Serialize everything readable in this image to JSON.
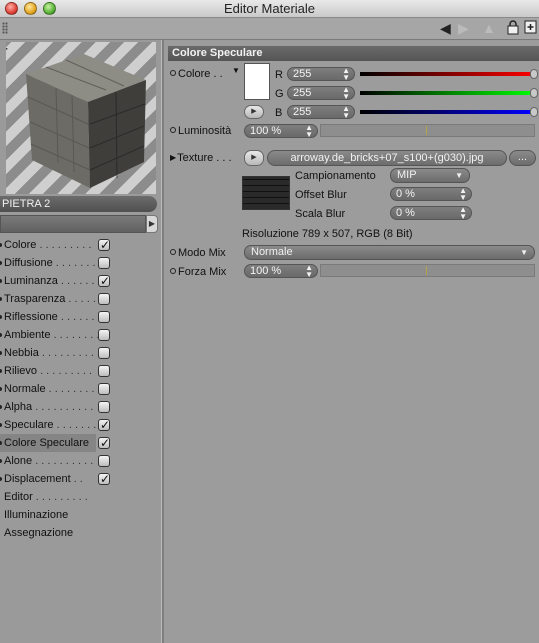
{
  "window": {
    "title": "Editor Materiale"
  },
  "toolbar": {
    "icons": [
      "back-arrow-icon",
      "forward-arrow-icon",
      "up-arrow-icon",
      "lock-icon",
      "new-window-icon"
    ]
  },
  "preview": {
    "material_name": "PIETRA 2"
  },
  "channels": [
    {
      "label": "Colore",
      "dots": " . . . . . . . . .",
      "checkbox": true,
      "checked": true,
      "bullet": true,
      "selected": false
    },
    {
      "label": "Diffusione",
      "dots": " . . . . . . .",
      "checkbox": true,
      "checked": false,
      "bullet": true,
      "selected": false
    },
    {
      "label": "Luminanza",
      "dots": " . . . . . .",
      "checkbox": true,
      "checked": true,
      "bullet": true,
      "selected": false
    },
    {
      "label": "Trasparenza",
      "dots": " . . . . .",
      "checkbox": true,
      "checked": false,
      "bullet": true,
      "selected": false
    },
    {
      "label": "Riflessione",
      "dots": " . . . . . .",
      "checkbox": true,
      "checked": false,
      "bullet": true,
      "selected": false
    },
    {
      "label": "Ambiente",
      "dots": " . . . . . . . .",
      "checkbox": true,
      "checked": false,
      "bullet": true,
      "selected": false
    },
    {
      "label": "Nebbia",
      "dots": " . . . . . . . . .",
      "checkbox": true,
      "checked": false,
      "bullet": true,
      "selected": false
    },
    {
      "label": "Rilievo",
      "dots": " . . . . . . . . .",
      "checkbox": true,
      "checked": false,
      "bullet": true,
      "selected": false
    },
    {
      "label": "Normale",
      "dots": " . . . . . . . .",
      "checkbox": true,
      "checked": false,
      "bullet": true,
      "selected": false
    },
    {
      "label": "Alpha",
      "dots": " . . . . . . . . . .",
      "checkbox": true,
      "checked": false,
      "bullet": true,
      "selected": false
    },
    {
      "label": "Speculare",
      "dots": " . . . . . . .",
      "checkbox": true,
      "checked": true,
      "bullet": true,
      "selected": false
    },
    {
      "label": "Colore Speculare",
      "dots": "",
      "checkbox": true,
      "checked": true,
      "bullet": true,
      "selected": true
    },
    {
      "label": "Alone",
      "dots": " . . . . . . . . . .",
      "checkbox": true,
      "checked": false,
      "bullet": true,
      "selected": false
    },
    {
      "label": "Displacement",
      "dots": " . .",
      "checkbox": true,
      "checked": true,
      "bullet": true,
      "selected": false
    },
    {
      "label": "Editor",
      "dots": " . . . . . . . . .",
      "checkbox": false,
      "checked": false,
      "bullet": false,
      "selected": false
    },
    {
      "label": "Illuminazione",
      "dots": "",
      "checkbox": false,
      "checked": false,
      "bullet": false,
      "selected": false
    },
    {
      "label": "Assegnazione",
      "dots": "",
      "checkbox": false,
      "checked": false,
      "bullet": false,
      "selected": false
    }
  ],
  "panel": {
    "section_title": "Colore Speculare",
    "colore": {
      "label": "Colore . .",
      "swatch_color": "#ffffff",
      "r_label": "R",
      "r_value": "255",
      "g_label": "G",
      "g_value": "255",
      "b_label": "B",
      "b_value": "255"
    },
    "luminosita": {
      "label": "Luminosità",
      "value": "100 %"
    },
    "texture": {
      "label": "Texture . . .",
      "filename": "arroway.de_bricks+07_s100+(g030).jpg",
      "more_button": "...",
      "campionamento_label": "Campionamento",
      "campionamento_value": "MIP",
      "offset_blur_label": "Offset Blur",
      "offset_blur_value": "0 %",
      "scala_blur_label": "Scala Blur",
      "scala_blur_value": "0 %",
      "resolution": "Risoluzione 789 x 507, RGB (8 Bit)"
    },
    "modo_mix": {
      "label": "Modo Mix",
      "value": "Normale"
    },
    "forza_mix": {
      "label": "Forza Mix",
      "value": "100 %"
    }
  }
}
